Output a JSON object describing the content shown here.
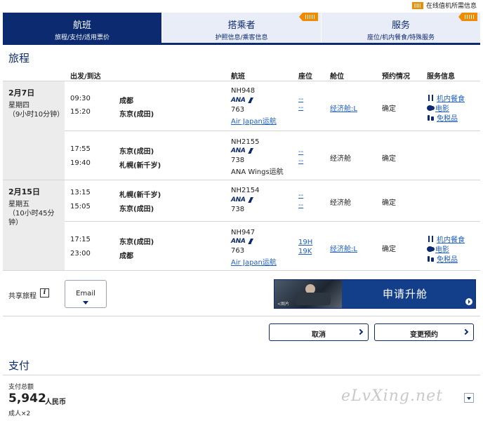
{
  "topbar": {
    "link": "在线值机所需信息"
  },
  "steps": [
    {
      "title": "航班",
      "sub": "旅程/支付/适用票价"
    },
    {
      "title": "搭乘者",
      "sub": "护照信息/乘客信息"
    },
    {
      "title": "服务",
      "sub": "座位/机内餐食/特殊服务"
    }
  ],
  "itinerary": {
    "title": "旅程",
    "headers": {
      "depart_arrive": "出发/到达",
      "flight": "航班",
      "seat": "座位",
      "cabin": "舱位",
      "booking": "预约情况",
      "services": "服务信息"
    },
    "days": [
      {
        "date": "2月7日",
        "weekday": "星期四",
        "duration": "（9小时10分钟）",
        "segments": [
          {
            "dep_time": "09:30",
            "dep_city": "成都",
            "arr_time": "15:20",
            "arr_city": "东京(成田)",
            "flight_no": "NH948",
            "airline": "ANA",
            "aircraft": "763",
            "operator": "Air Japan运航",
            "seat1": "--",
            "seat2": "--",
            "cabin": "经济舱:L",
            "status": "确定",
            "services": [
              "机内餐食",
              "电影",
              "免税品"
            ]
          },
          {
            "dep_time": "17:55",
            "dep_city": "东京(成田)",
            "arr_time": "19:40",
            "arr_city": "札幌(新千岁)",
            "flight_no": "NH2155",
            "airline": "ANA",
            "aircraft": "738",
            "operator": "ANA Wings运航",
            "seat1": "--",
            "seat2": "--",
            "cabin": "经济舱",
            "status": "确定",
            "services": []
          }
        ]
      },
      {
        "date": "2月15日",
        "weekday": "星期五",
        "duration": "（10小时45分钟）",
        "segments": [
          {
            "dep_time": "13:15",
            "dep_city": "札幌(新千岁)",
            "arr_time": "15:05",
            "arr_city": "东京(成田)",
            "flight_no": "NH2154",
            "airline": "ANA",
            "aircraft": "738",
            "operator": "",
            "seat1": "--",
            "seat2": "--",
            "cabin": "经济舱",
            "status": "确定",
            "services": []
          },
          {
            "dep_time": "17:15",
            "dep_city": "东京(成田)",
            "arr_time": "23:00",
            "arr_city": "成都",
            "flight_no": "NH947",
            "airline": "ANA",
            "aircraft": "763",
            "operator": "Air Japan运航",
            "seat1": "19H",
            "seat2": "19K",
            "cabin": "经济舱:L",
            "status": "确定",
            "services": [
              "机内餐食",
              "电影",
              "免税品"
            ]
          }
        ]
      }
    ]
  },
  "share": {
    "label": "共享旅程",
    "info": "i",
    "email": "Email"
  },
  "upgrade": {
    "text": "申请升舱",
    "photo_caption": "<图片"
  },
  "actions": {
    "cancel": "取消",
    "change": "变更预约"
  },
  "payment": {
    "title": "支付",
    "total_label": "支付总额",
    "amount": "5,942",
    "currency": "人民币",
    "pax": "成人×2"
  },
  "watermark": "eLvXing.net",
  "colors": {
    "navy": "#0b2a6f",
    "link": "#1f5fbf",
    "orange": "#f08a00"
  }
}
